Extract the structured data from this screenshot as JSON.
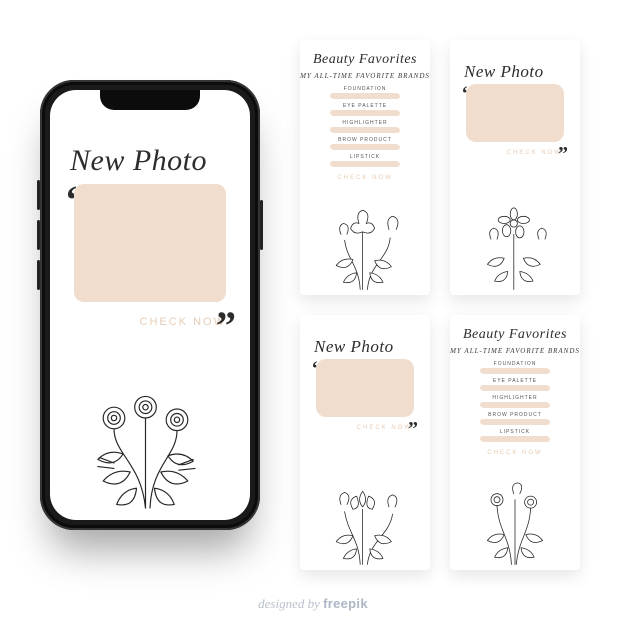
{
  "colors": {
    "accent": "#f1ddcd",
    "accent_text": "#e6cdb7"
  },
  "phone_card": {
    "kind": "np",
    "title": "New Photo",
    "cta": "CHECK NOW"
  },
  "thumbs": [
    {
      "kind": "bf",
      "title": "Beauty Favorites",
      "subtitle": "MY ALL-TIME FAVORITE BRANDS",
      "items": [
        "FOUNDATION",
        "EYE PALETTE",
        "HIGHLIGHTER",
        "BROW PRODUCT",
        "LIPSTICK"
      ],
      "cta": "CHECK NOW",
      "flower_variant": "a"
    },
    {
      "kind": "np",
      "title": "New Photo",
      "cta": "CHECK NOW",
      "flower_variant": "b"
    },
    {
      "kind": "np",
      "title": "New Photo",
      "cta": "CHECK NOW",
      "flower_variant": "c"
    },
    {
      "kind": "bf",
      "title": "Beauty Favorites",
      "subtitle": "MY ALL-TIME FAVORITE BRANDS",
      "items": [
        "FOUNDATION",
        "EYE PALETTE",
        "HIGHLIGHTER",
        "BROW PRODUCT",
        "LIPSTICK"
      ],
      "cta": "CHECK NOW",
      "flower_variant": "d"
    }
  ],
  "credit": {
    "prefix": "designed by ",
    "brand": "freepik"
  }
}
